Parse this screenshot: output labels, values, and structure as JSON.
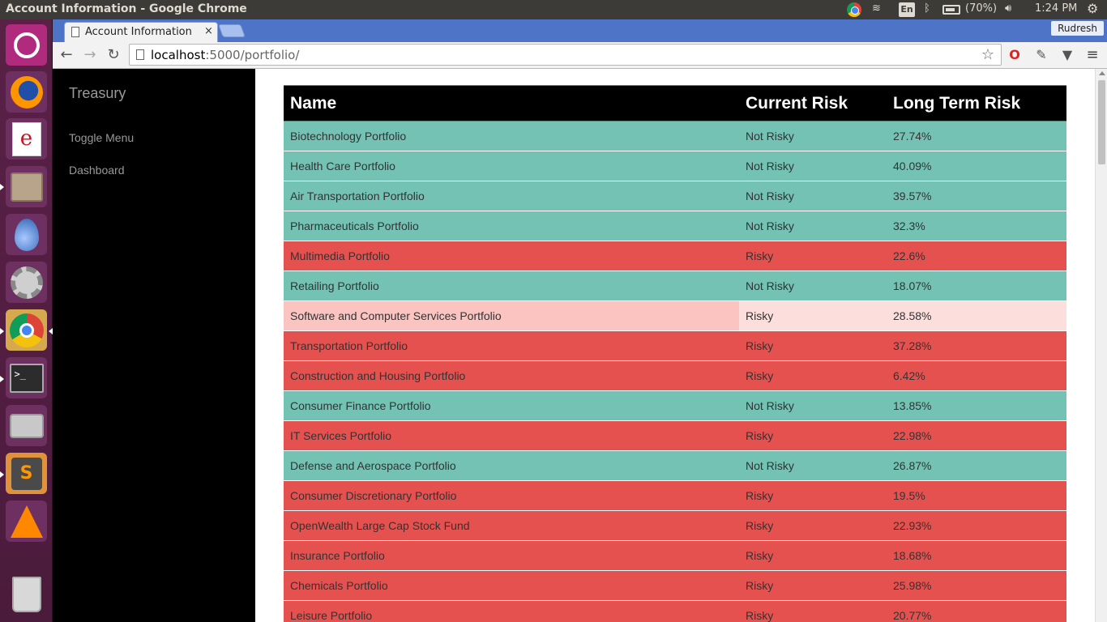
{
  "os_panel": {
    "window_title": "Account Information - Google Chrome",
    "keyboard_layout": "En",
    "battery": "(70%)",
    "clock": "1:24 PM"
  },
  "browser": {
    "tab_title": "Account Information",
    "tab_close": "×",
    "profile_name": "Rudresh",
    "url_host": "localhost",
    "url_rest": ":5000/portfolio/"
  },
  "sidebar": {
    "brand": "Treasury",
    "links": [
      "Toggle Menu",
      "Dashboard"
    ]
  },
  "table": {
    "headers": [
      "Name",
      "Current Risk",
      "Long Term Risk"
    ],
    "rows": [
      {
        "name": "Biotechnology Portfolio",
        "current_risk": "Not Risky",
        "long_term_risk": "27.74%"
      },
      {
        "name": "Health Care Portfolio",
        "current_risk": "Not Risky",
        "long_term_risk": "40.09%"
      },
      {
        "name": "Air Transportation Portfolio",
        "current_risk": "Not Risky",
        "long_term_risk": "39.57%"
      },
      {
        "name": "Pharmaceuticals Portfolio",
        "current_risk": "Not Risky",
        "long_term_risk": "32.3%"
      },
      {
        "name": "Multimedia Portfolio",
        "current_risk": "Risky",
        "long_term_risk": "22.6%"
      },
      {
        "name": "Retailing Portfolio",
        "current_risk": "Not Risky",
        "long_term_risk": "18.07%"
      },
      {
        "name": "Software and Computer Services Portfolio",
        "current_risk": "Risky",
        "long_term_risk": "28.58%",
        "hovered": true
      },
      {
        "name": "Transportation Portfolio",
        "current_risk": "Risky",
        "long_term_risk": "37.28%"
      },
      {
        "name": "Construction and Housing Portfolio",
        "current_risk": "Risky",
        "long_term_risk": "6.42%"
      },
      {
        "name": "Consumer Finance Portfolio",
        "current_risk": "Not Risky",
        "long_term_risk": "13.85%"
      },
      {
        "name": "IT Services Portfolio",
        "current_risk": "Risky",
        "long_term_risk": "22.98%"
      },
      {
        "name": "Defense and Aerospace Portfolio",
        "current_risk": "Not Risky",
        "long_term_risk": "26.87%"
      },
      {
        "name": "Consumer Discretionary Portfolio",
        "current_risk": "Risky",
        "long_term_risk": "19.5%"
      },
      {
        "name": "OpenWealth Large Cap Stock Fund",
        "current_risk": "Risky",
        "long_term_risk": "22.93%"
      },
      {
        "name": "Insurance Portfolio",
        "current_risk": "Risky",
        "long_term_risk": "18.68%"
      },
      {
        "name": "Chemicals Portfolio",
        "current_risk": "Risky",
        "long_term_risk": "25.98%"
      },
      {
        "name": "Leisure Portfolio",
        "current_risk": "Risky",
        "long_term_risk": "20.77%"
      }
    ]
  },
  "colors": {
    "not_risky_row": "#73c2b3",
    "risky_row": "#e5514f",
    "sidebar_bg": "#000000",
    "header_bg": "#000000"
  }
}
